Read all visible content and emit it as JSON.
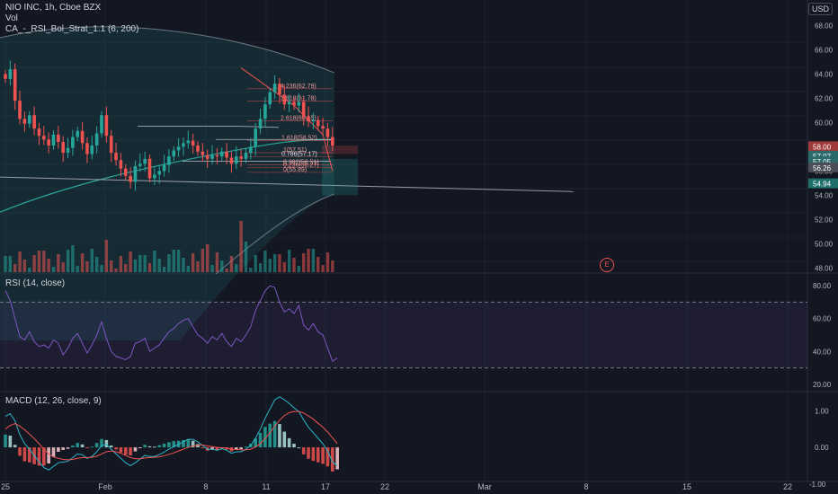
{
  "header": {
    "symbol_line": "NIO INC, 1h, Cboe BZX",
    "vol_label": "Vol",
    "strategy_label": "CA_-_RSI_Bol_Strat_1.1 (6, 200)",
    "currency_badge": "USD"
  },
  "rsi_panel": {
    "label": "RSI (14, close)"
  },
  "macd_panel": {
    "label": "MACD (12, 26, close, 9)"
  },
  "earnings_marker": "E",
  "price_axis": {
    "ticks": [
      "68.00",
      "66.00",
      "64.00",
      "62.00",
      "60.00",
      "58.00",
      "56.00",
      "54.00",
      "52.00",
      "50.00",
      "48.00"
    ],
    "badges": [
      {
        "text": "58.00",
        "bg": "#a03a3a"
      },
      {
        "text": "57.07",
        "bg": "#2b6a6a"
      },
      {
        "text": "57.05",
        "bg": "#2b6a6a"
      },
      {
        "text": "56.26",
        "bg": "#4a4e58"
      },
      {
        "text": "54.94",
        "bg": "#1e6e6a"
      }
    ]
  },
  "rsi_axis": {
    "ticks": [
      "80.00",
      "60.00",
      "40.00",
      "20.00"
    ]
  },
  "macd_axis": {
    "ticks": [
      "1.00",
      "0.00",
      "-1.00"
    ]
  },
  "time_axis": {
    "labels": [
      "25",
      "Feb",
      "8",
      "11",
      "17",
      "22",
      "Mar",
      "8",
      "15",
      "22"
    ]
  },
  "fib_labels": [
    "4.236(62.79)",
    "3.618(61.78)",
    "2.618(60.15)",
    "1.618(58.52)",
    "1(57.51)",
    "0.786(57.17)",
    "0.382(56.51)",
    "0.236(56.27)",
    "0(55.89)"
  ],
  "colors": {
    "background": "#131722",
    "bull": "#26a69a",
    "bear": "#ef5350",
    "basis": "#2aa59a",
    "rsi_line": "#7e57c2",
    "macd_line": "#2bb7c9",
    "signal_line": "#ef5350",
    "grid": "#1e222d"
  },
  "chart_data": [
    {
      "type": "candlestick",
      "title": "NIO INC, 1h, Cboe BZX",
      "ylim": [
        47.5,
        69
      ],
      "x_labels": [
        "25",
        "Feb",
        "8",
        "11",
        "17",
        "22",
        "Mar",
        "8",
        "15",
        "22"
      ],
      "close": [
        63.6,
        64.4,
        61.8,
        60.3,
        59.9,
        60.6,
        59.5,
        58.9,
        58.6,
        58.1,
        59.0,
        58.4,
        57.5,
        57.9,
        58.8,
        59.3,
        58.3,
        57.4,
        58.1,
        59.1,
        60.6,
        58.9,
        57.5,
        56.9,
        56.2,
        55.6,
        55.1,
        56.4,
        56.6,
        57.0,
        55.4,
        55.7,
        56.0,
        56.5,
        57.2,
        57.7,
        58.0,
        58.3,
        58.5,
        58.1,
        57.6,
        57.3,
        57.0,
        57.3,
        57.2,
        57.6,
        57.1,
        56.6,
        57.2,
        57.0,
        57.5,
        58.0,
        59.5,
        60.3,
        61.5,
        62.5,
        63.2,
        62.3,
        61.5,
        61.7,
        61.4,
        61.7,
        60.5,
        60.1,
        60.2,
        59.7,
        59.5,
        58.8,
        58.1
      ],
      "volume_shown": true
    },
    {
      "type": "line",
      "title": "RSI (14, close)",
      "ylim": [
        15,
        85
      ],
      "bands": [
        70,
        30
      ],
      "values": [
        77,
        71,
        60,
        49,
        47,
        52,
        46,
        43,
        44,
        42,
        47,
        45,
        38,
        42,
        48,
        51,
        45,
        39,
        44,
        50,
        58,
        48,
        40,
        37,
        36,
        35,
        37,
        45,
        46,
        48,
        40,
        42,
        44,
        48,
        52,
        54,
        57,
        59,
        60,
        55,
        50,
        48,
        45,
        49,
        47,
        51,
        46,
        43,
        48,
        46,
        50,
        55,
        65,
        71,
        77,
        80,
        79,
        70,
        64,
        66,
        63,
        68,
        56,
        53,
        57,
        52,
        50,
        42,
        34,
        36
      ]
    },
    {
      "type": "line",
      "title": "MACD (12, 26, close, 9)",
      "ylim": [
        -1.25,
        1.45
      ],
      "series": [
        {
          "name": "MACD",
          "values": [
            0.85,
            0.92,
            0.72,
            0.35,
            0.1,
            -0.05,
            -0.22,
            -0.4,
            -0.55,
            -0.62,
            -0.52,
            -0.42,
            -0.4,
            -0.38,
            -0.28,
            -0.18,
            -0.2,
            -0.3,
            -0.25,
            -0.12,
            0.05,
            0.08,
            -0.05,
            -0.18,
            -0.3,
            -0.42,
            -0.5,
            -0.42,
            -0.32,
            -0.22,
            -0.25,
            -0.25,
            -0.2,
            -0.13,
            -0.05,
            0.02,
            0.08,
            0.15,
            0.22,
            0.22,
            0.15,
            0.05,
            -0.05,
            -0.05,
            -0.08,
            -0.04,
            -0.08,
            -0.16,
            -0.12,
            -0.12,
            -0.05,
            0.05,
            0.25,
            0.5,
            0.8,
            1.05,
            1.3,
            1.38,
            1.3,
            1.2,
            1.08,
            0.98,
            0.75,
            0.55,
            0.4,
            0.25,
            0.1,
            -0.1,
            -0.4,
            -0.5
          ]
        },
        {
          "name": "Signal",
          "values": [
            0.5,
            0.6,
            0.65,
            0.58,
            0.48,
            0.36,
            0.24,
            0.1,
            -0.05,
            -0.18,
            -0.26,
            -0.3,
            -0.33,
            -0.34,
            -0.33,
            -0.3,
            -0.28,
            -0.28,
            -0.27,
            -0.24,
            -0.18,
            -0.12,
            -0.1,
            -0.12,
            -0.16,
            -0.22,
            -0.28,
            -0.31,
            -0.31,
            -0.29,
            -0.28,
            -0.27,
            -0.26,
            -0.23,
            -0.19,
            -0.15,
            -0.1,
            -0.05,
            0.0,
            0.04,
            0.06,
            0.06,
            0.04,
            0.02,
            0.0,
            -0.01,
            -0.02,
            -0.05,
            -0.06,
            -0.07,
            -0.07,
            -0.05,
            0.01,
            0.1,
            0.24,
            0.4,
            0.58,
            0.74,
            0.87,
            0.95,
            0.98,
            0.98,
            0.94,
            0.86,
            0.77,
            0.66,
            0.55,
            0.42,
            0.26,
            0.1
          ]
        }
      ]
    }
  ]
}
